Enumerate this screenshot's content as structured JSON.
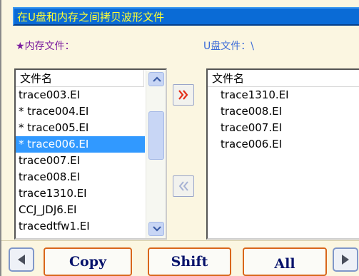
{
  "title": "在U盘和内存之间拷贝波形文件",
  "memory_label": "★内存文件：",
  "udisk_label": "U盘文件：\\",
  "left_list": {
    "header": "文件名",
    "rows": [
      {
        "name": "trace003.EI",
        "selected": false
      },
      {
        "name": "* trace004.EI",
        "selected": false
      },
      {
        "name": "* trace005.EI",
        "selected": false
      },
      {
        "name": "* trace006.EI",
        "selected": true
      },
      {
        "name": "trace007.EI",
        "selected": false
      },
      {
        "name": "trace008.EI",
        "selected": false
      },
      {
        "name": "trace1310.EI",
        "selected": false
      },
      {
        "name": "CCJ_JDJ6.EI",
        "selected": false
      },
      {
        "name": "tracedtfw1.EI",
        "selected": false
      }
    ]
  },
  "right_list": {
    "header": "文件名",
    "rows": [
      "trace1310.EI",
      "trace008.EI",
      "trace007.EI",
      "trace006.EI"
    ]
  },
  "buttons": {
    "move_right": "»",
    "move_left": "«",
    "copy": "Copy",
    "shift": "Shift",
    "all": "All"
  },
  "icons": {
    "move_right": "double-chevron-right-icon",
    "move_left": "double-chevron-left-icon",
    "prev": "triangle-left-icon",
    "next": "triangle-right-icon"
  },
  "colors": {
    "title_bg": "#0a6bd6",
    "title_text": "#ffff33",
    "selection": "#3199ff",
    "button_border": "#d9661a",
    "button_text": "#06126b"
  }
}
